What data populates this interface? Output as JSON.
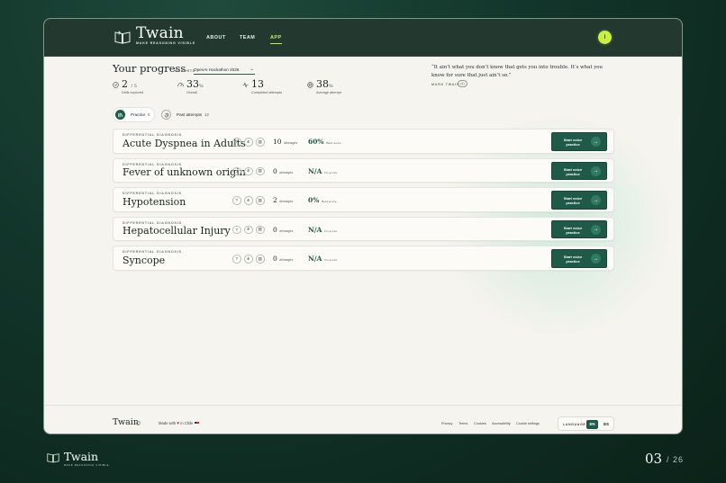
{
  "app": {
    "brand": "Twain",
    "tagline": "MAKE REASONING VISIBLE",
    "nav": [
      {
        "label": "ABOUT"
      },
      {
        "label": "TEAM"
      },
      {
        "label": "APP"
      }
    ],
    "active_nav": "APP",
    "user_initial": "I"
  },
  "progress": {
    "title": "Your progress",
    "cohort_label": "COHORTS",
    "cohort_value": "OpenAI Hackathon 2026",
    "stats": [
      {
        "value": "2",
        "suffix": "/ 5",
        "label": "Drills explored",
        "icon": "check-circle-icon"
      },
      {
        "value": "33",
        "suffix": "%",
        "label": "Overall",
        "icon": "gauge-icon"
      },
      {
        "value": "13",
        "suffix": "",
        "label": "Completed attempts",
        "icon": "activity-icon"
      },
      {
        "value": "38",
        "suffix": "%",
        "label": "Average attempt",
        "icon": "target-icon"
      }
    ]
  },
  "quote": {
    "text": "“It ain’t what you don’t know that gets you into trouble. It’s what you know for sure that just ain’t so.”",
    "author": "MARK TWAIN",
    "button": "(1)"
  },
  "filters": {
    "practice_label": "Practice",
    "practice_count": "5",
    "past_label": "Past attempts",
    "past_count": "13"
  },
  "drills": [
    {
      "category": "DIFFERENTIAL DIAGNOSIS",
      "name": "Acute Dyspnea in Adults",
      "attempts": "10",
      "attempts_label": "attempts",
      "score": "60%",
      "score_label": "Best score",
      "cta": "Start voice practice"
    },
    {
      "category": "DIFFERENTIAL DIAGNOSIS",
      "name": "Fever of unknown origin",
      "attempts": "0",
      "attempts_label": "attempts",
      "score": "N/A",
      "score_label": "No score",
      "cta": "Start voice practice"
    },
    {
      "category": "DIFFERENTIAL DIAGNOSIS",
      "name": "Hypotension",
      "attempts": "2",
      "attempts_label": "attempts",
      "score": "0%",
      "score_label": "Best score",
      "cta": "Start voice practice"
    },
    {
      "category": "DIFFERENTIAL DIAGNOSIS",
      "name": "Hepatocellular Injury",
      "attempts": "0",
      "attempts_label": "attempts",
      "score": "N/A",
      "score_label": "No score",
      "cta": "Start voice practice"
    },
    {
      "category": "DIFFERENTIAL DIAGNOSIS",
      "name": "Syncope",
      "attempts": "0",
      "attempts_label": "attempts",
      "score": "N/A",
      "score_label": "No score",
      "cta": "Start voice practice"
    }
  ],
  "footer": {
    "brand": "Twain",
    "made_with": "Made with",
    "in_chile": "in Chile",
    "links": [
      "Privacy",
      "Terms",
      "Cookies",
      "Accessibility",
      "Cookie settings"
    ],
    "language_label": "LANGUAGE",
    "languages": [
      "EN",
      "ES"
    ],
    "active_language": "EN"
  },
  "slide": {
    "brand": "Twain",
    "tagline": "MAKE REASONING VISIBLE",
    "page": "03",
    "total": "/ 26"
  },
  "colors": {
    "accent": "#1f5a48",
    "highlight": "#c8f23e",
    "header_bg": "#23392f",
    "page_bg": "#f6f4ee"
  }
}
